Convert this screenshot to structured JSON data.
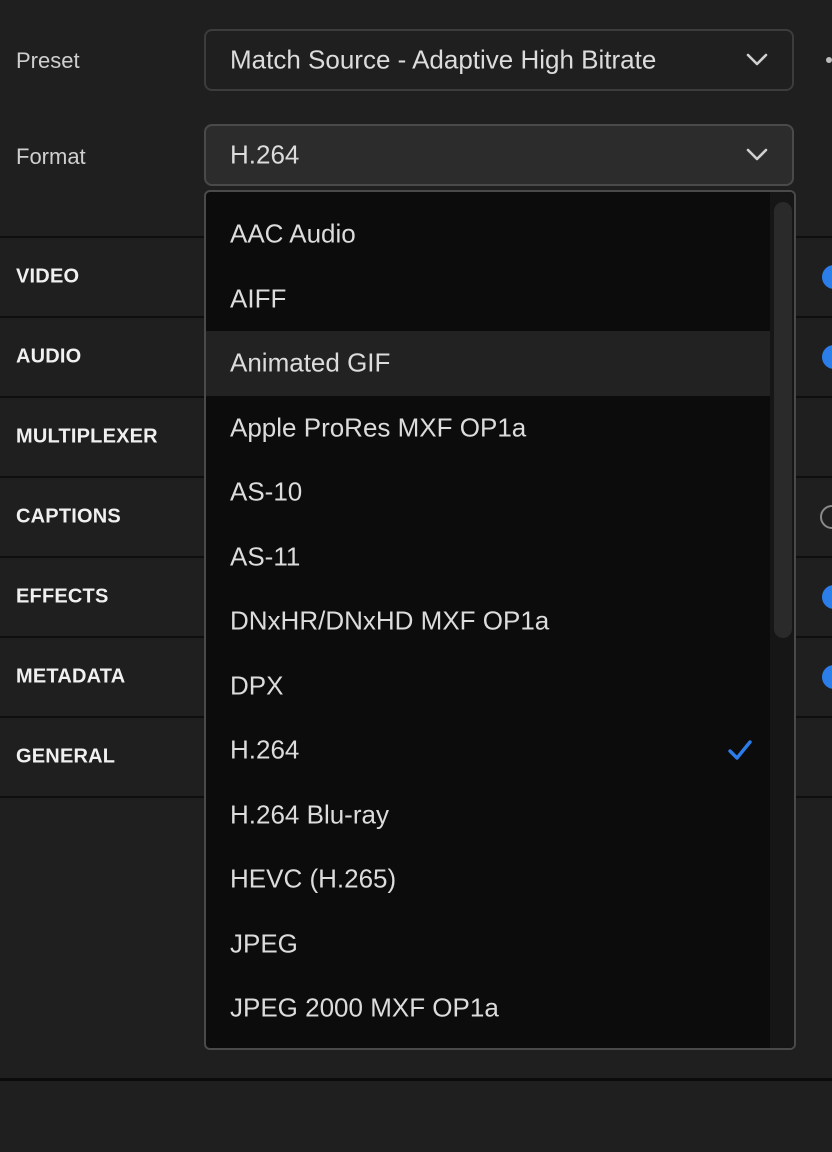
{
  "preset": {
    "label": "Preset",
    "value": "Match Source - Adaptive High Bitrate",
    "icon": "chevron-down-icon"
  },
  "format": {
    "label": "Format",
    "value": "H.264",
    "icon": "chevron-down-icon"
  },
  "sections": [
    {
      "label": "VIDEO",
      "toggle": "on"
    },
    {
      "label": "AUDIO",
      "toggle": "on"
    },
    {
      "label": "MULTIPLEXER",
      "toggle": "none"
    },
    {
      "label": "CAPTIONS",
      "toggle": "off"
    },
    {
      "label": "EFFECTS",
      "toggle": "on"
    },
    {
      "label": "METADATA",
      "toggle": "on"
    },
    {
      "label": "GENERAL",
      "toggle": "none"
    }
  ],
  "format_dropdown": {
    "options": [
      {
        "label": "AAC Audio"
      },
      {
        "label": "AIFF"
      },
      {
        "label": "Animated GIF",
        "hovered": true
      },
      {
        "label": "Apple ProRes MXF OP1a"
      },
      {
        "label": "AS-10"
      },
      {
        "label": "AS-11"
      },
      {
        "label": "DNxHR/DNxHD MXF OP1a"
      },
      {
        "label": "DPX"
      },
      {
        "label": "H.264",
        "selected": true
      },
      {
        "label": "H.264 Blu-ray"
      },
      {
        "label": "HEVC (H.265)"
      },
      {
        "label": "JPEG"
      },
      {
        "label": "JPEG 2000 MXF OP1a"
      }
    ],
    "selected_icon": "checkmark-icon"
  },
  "colors": {
    "accent": "#2b7de9",
    "background": "#1f1f1f",
    "dropdown_background": "#0c0c0c",
    "hover": "#222222"
  }
}
